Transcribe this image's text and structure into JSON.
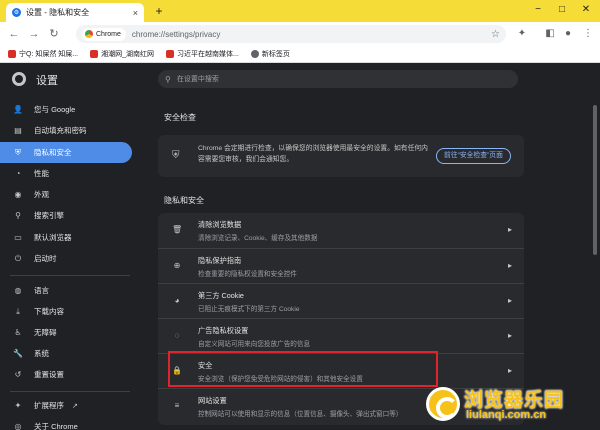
{
  "browser": {
    "tab_title": "设置 - 隐私和安全",
    "tab_close": "×",
    "new_tab": "+",
    "win_minimize": "−",
    "win_maximize": "□",
    "win_close": "✕",
    "address_chip": "Chrome",
    "url": "chrome://settings/privacy",
    "bookmarks": [
      {
        "label": "宁Q: 知屎然 知屎...",
        "color": "#d93025"
      },
      {
        "label": "湘潮网_湖南红网",
        "color": "#d93025"
      },
      {
        "label": "习近平在越南媒体...",
        "color": "#d93025"
      },
      {
        "label": "新标签页",
        "color": "#5f6368"
      }
    ]
  },
  "settings": {
    "title": "设置",
    "search_placeholder": "在设置中搜索",
    "sidebar": [
      {
        "label": "您与 Google",
        "icon": "person-icon",
        "glyph": "👤"
      },
      {
        "label": "自动填充和密码",
        "icon": "clipboard-icon",
        "glyph": "▤"
      },
      {
        "label": "隐私和安全",
        "icon": "shield-icon",
        "glyph": "⛨",
        "active": true
      },
      {
        "label": "性能",
        "icon": "speed-icon",
        "glyph": "◔"
      },
      {
        "label": "外观",
        "icon": "palette-icon",
        "glyph": "◉"
      },
      {
        "label": "搜索引擎",
        "icon": "search-icon",
        "glyph": "⚲"
      },
      {
        "label": "默认浏览器",
        "icon": "browser-icon",
        "glyph": "▭"
      },
      {
        "label": "启动时",
        "icon": "power-icon",
        "glyph": "⏻"
      },
      {
        "label": "语言",
        "icon": "globe-icon",
        "glyph": "◍"
      },
      {
        "label": "下载内容",
        "icon": "download-icon",
        "glyph": "⤓"
      },
      {
        "label": "无障碍",
        "icon": "accessibility-icon",
        "glyph": "♿"
      },
      {
        "label": "系统",
        "icon": "wrench-icon",
        "glyph": "🔧"
      },
      {
        "label": "重置设置",
        "icon": "reset-icon",
        "glyph": "↺"
      },
      {
        "label": "扩展程序",
        "icon": "puzzle-icon",
        "glyph": "✦",
        "ext": "↗"
      },
      {
        "label": "关于 Chrome",
        "icon": "chrome-icon",
        "glyph": "◎"
      }
    ],
    "safety_check": {
      "heading": "安全检查",
      "description": "Chrome 会定期进行检查，以确保您的浏览器使用最安全的设置。如有任何内容需要您审核，我们会通知您。",
      "button": "前往“安全检查”页面"
    },
    "privacy": {
      "heading": "隐私和安全",
      "rows": [
        {
          "title": "清除浏览数据",
          "subtitle": "清除浏览记录、Cookie、缓存及其他数据",
          "icon": "trash-icon",
          "glyph": "🗑",
          "end": "▸"
        },
        {
          "title": "隐私保护指南",
          "subtitle": "检查重要的隐私权设置和安全控件",
          "icon": "guide-icon",
          "glyph": "⊕",
          "end": "▸"
        },
        {
          "title": "第三方 Cookie",
          "subtitle": "已阻止无痕模式下的第三方 Cookie",
          "icon": "cookie-icon",
          "glyph": "◕",
          "end": "▸"
        },
        {
          "title": "广告隐私权设置",
          "subtitle": "自定义网站可用来向您投放广告的信息",
          "icon": "ads-icon",
          "glyph": "◌",
          "end": "▸"
        },
        {
          "title": "安全",
          "subtitle": "安全浏览（保护您免受危险网站的侵害）和其他安全设置",
          "icon": "lock-icon",
          "glyph": "🔒",
          "end": "▸"
        },
        {
          "title": "网站设置",
          "subtitle": "控制网站可以使用和显示的信息（位置信息、摄像头、弹出式窗口等）",
          "icon": "tune-icon",
          "glyph": "≡",
          "end": "▸"
        }
      ]
    }
  },
  "watermark": {
    "cn": "浏览器乐园",
    "en": "liulanqi.com.cn"
  }
}
